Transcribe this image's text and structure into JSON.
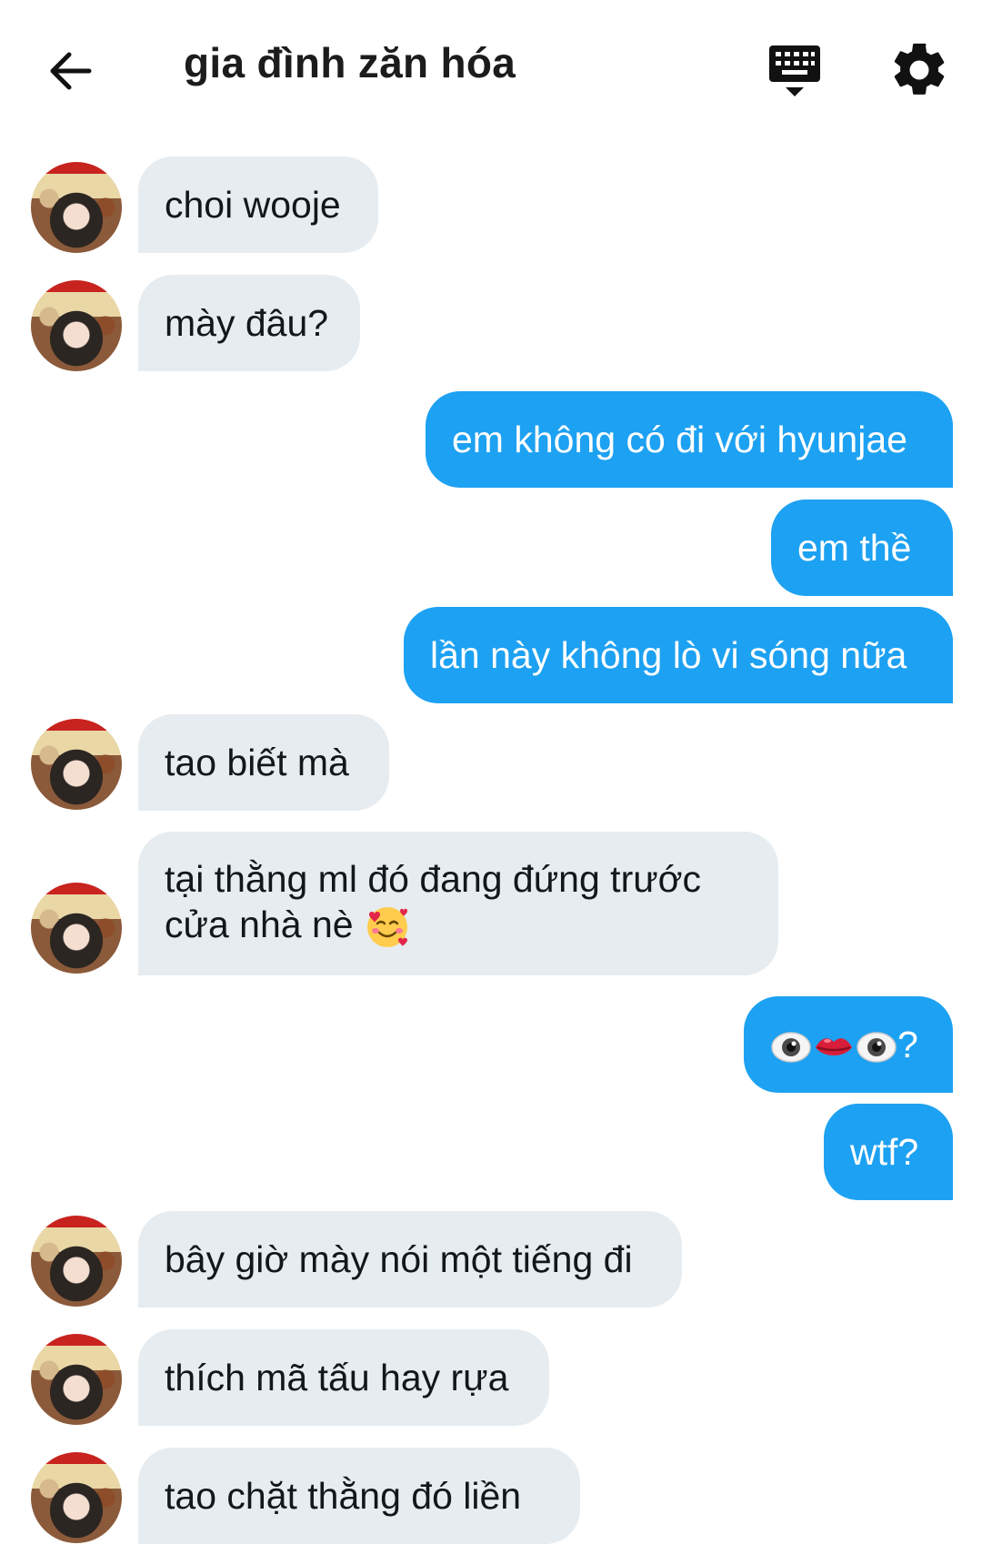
{
  "header": {
    "title": "gia đình zăn hóa",
    "icons": [
      "back-arrow-icon",
      "keyboard-icon",
      "gear-icon"
    ]
  },
  "messages": [
    {
      "side": "in",
      "text": "choi wooje"
    },
    {
      "side": "in",
      "text": "mày đâu?"
    },
    {
      "side": "out",
      "text": "em không có đi với hyunjae"
    },
    {
      "side": "out",
      "text": "em thề"
    },
    {
      "side": "out",
      "text": "lần này không lò vi sóng nữa"
    },
    {
      "side": "in",
      "text": "tao biết mà"
    },
    {
      "side": "in",
      "line1": "tại thằng ml đó đang đứng trước",
      "line2": "cửa nhà nè",
      "emoji": "smiling-face-with-hearts"
    },
    {
      "side": "out",
      "text": "?",
      "emojis": [
        "eye",
        "mouth",
        "eye"
      ]
    },
    {
      "side": "out",
      "text": "wtf?"
    },
    {
      "side": "in",
      "text": "bây giờ mày nói một tiếng đi"
    },
    {
      "side": "in",
      "text": "thích mã tấu hay rựa"
    },
    {
      "side": "in",
      "text": "tao chặt thằng đó liền"
    }
  ],
  "colors": {
    "incoming_bubble": "#e6ecf0",
    "outgoing_bubble": "#1da1f2",
    "text_dark": "#14171a"
  }
}
